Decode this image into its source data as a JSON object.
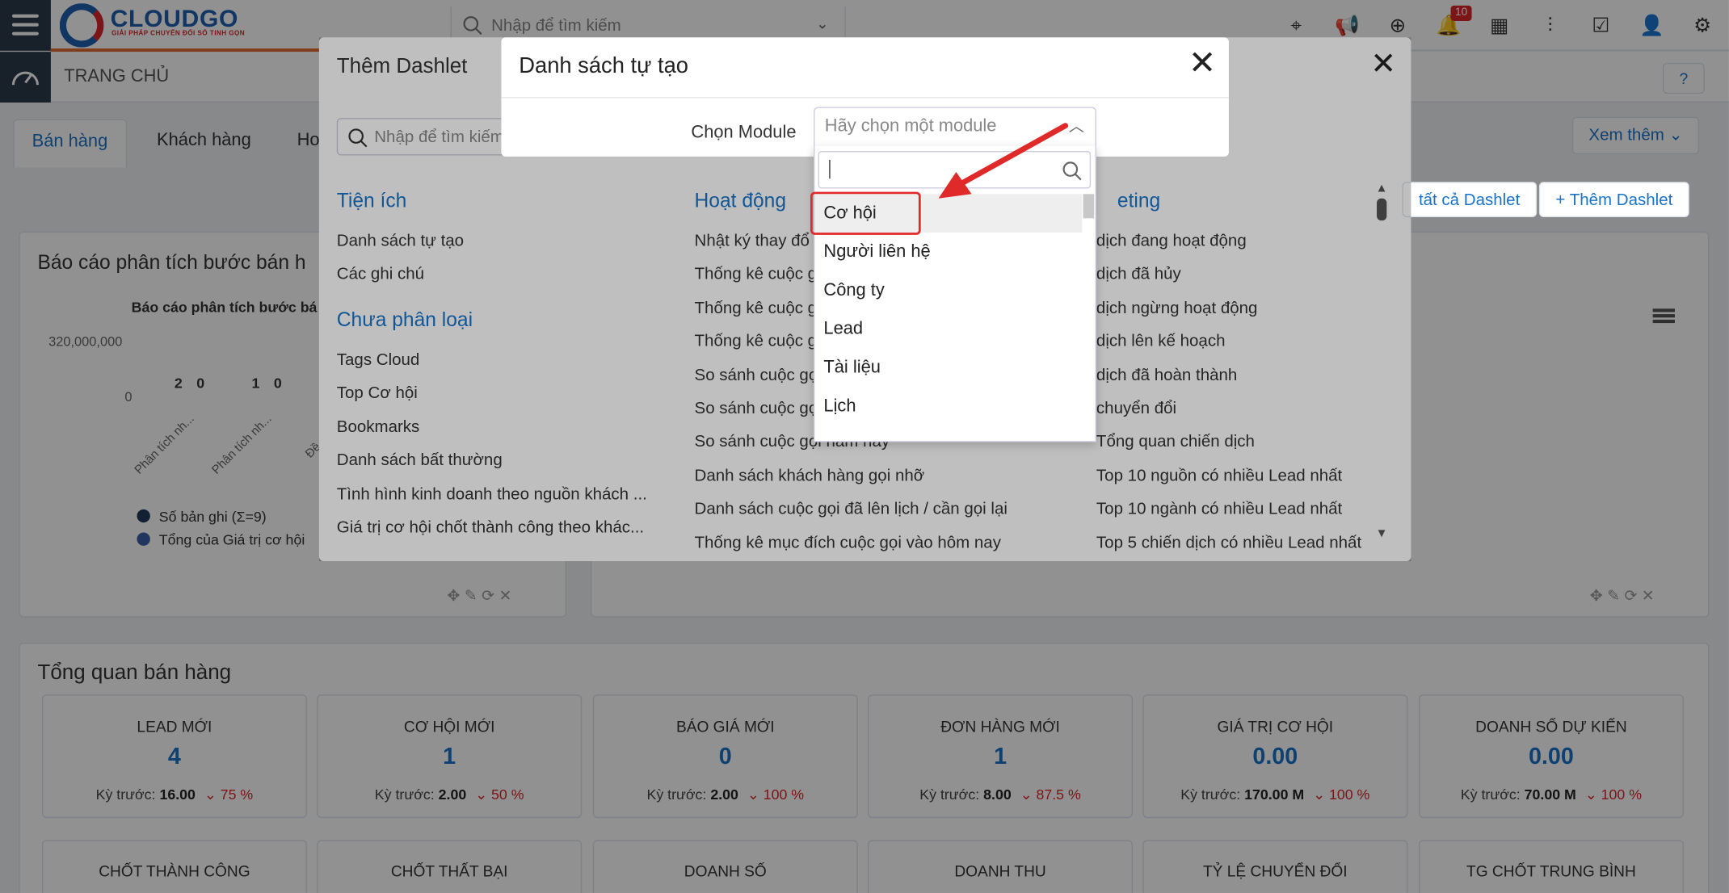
{
  "header": {
    "logo": "CLOUDGO",
    "logo_sub": "GIẢI PHÁP CHUYỂN ĐỔI SỐ TINH GỌN",
    "search_placeholder": "Nhập để tìm kiếm",
    "notification_count": "10",
    "icons": [
      "map-marker-icon",
      "megaphone-icon",
      "plus-circle-icon",
      "bell-icon",
      "calendar-icon",
      "chart-icon",
      "checkbox-icon",
      "user-icon",
      "gear-icon"
    ]
  },
  "subbar": {
    "title": "TRANG CHỦ",
    "help": "?"
  },
  "tabs": [
    "Bán hàng",
    "Khách hàng",
    "Ho"
  ],
  "see_more": "Xem thêm",
  "panel1": {
    "title": "Báo cáo phân tích bước bán h",
    "chart_title": "Báo cáo phân tích bước bá"
  },
  "chart_data": {
    "type": "bar",
    "title": "Báo cáo phân tích bước bá",
    "categories": [
      "Phân tích nh...",
      "Phân tích nh...",
      "Đề xuất/..."
    ],
    "yticks": [
      "320,000,000",
      "0"
    ],
    "data_labels": [
      "2",
      "0",
      "1",
      "0"
    ],
    "series": [
      {
        "name": "Số bản ghi (Σ=9)",
        "color": "#1f3a5a"
      },
      {
        "name": "Tổng của Giá trị cơ hội",
        "color": "#3a5fa8"
      }
    ]
  },
  "overview": {
    "title": "Tổng quan bán hàng",
    "prev_label": "Kỳ trước:",
    "cards": [
      {
        "title": "LEAD MỚI",
        "value": "4",
        "prev": "16.00",
        "change": "75 %"
      },
      {
        "title": "CƠ HỘI MỚI",
        "value": "1",
        "prev": "2.00",
        "change": "50 %"
      },
      {
        "title": "BÁO GIÁ MỚI",
        "value": "0",
        "prev": "2.00",
        "change": "100 %"
      },
      {
        "title": "ĐƠN HÀNG MỚI",
        "value": "1",
        "prev": "8.00",
        "change": "87.5 %"
      },
      {
        "title": "GIÁ TRỊ CƠ HỘI",
        "value": "0.00",
        "prev": "170.00 M",
        "change": "100 %"
      },
      {
        "title": "DOANH SỐ DỰ KIẾN",
        "value": "0.00",
        "prev": "70.00 M",
        "change": "100 %"
      }
    ],
    "cards2": [
      "CHỐT THÀNH CÔNG",
      "CHỐT THẤT BẠI",
      "DOANH SỐ",
      "DOANH THU",
      "TỶ LỆ CHUYỂN ĐỔI",
      "TG CHỐT TRUNG BÌNH"
    ]
  },
  "dashlet_dialog": {
    "title": "Thêm Dashlet",
    "search_placeholder": "Nhập để tìm kiếm",
    "all_dashlets": "tất cả Dashlet",
    "add_dashlet": "+ Thêm Dashlet",
    "col1_title": "Tiện ích",
    "col1_items": [
      "Danh sách tự tạo",
      "Các ghi chú"
    ],
    "col1b_title": "Chưa phân loại",
    "col1b_items": [
      "Tags Cloud",
      "Top Cơ hội",
      "Bookmarks",
      "Danh sách bất thường",
      "Tình hình kinh doanh theo nguồn khách ...",
      "Giá trị cơ hội chốt thành công theo khác..."
    ],
    "col2_title": "Hoạt động",
    "col2_items": [
      "Nhật ký thay đổ",
      "Thống kê cuộc g",
      "Thống kê cuộc g",
      "Thống kê cuộc g",
      "So sánh cuộc gọ",
      "So sánh cuộc gọ",
      "So sánh cuộc gọi năm nay",
      "Danh sách khách hàng gọi nhỡ",
      "Danh sách cuộc gọi đã lên lịch / cần gọi lại",
      "Thống kê mục đích cuộc gọi vào hôm nay"
    ],
    "col3_title": "eting",
    "col3_items": [
      "dịch đang hoạt động",
      "dịch đã hủy",
      "dịch ngừng hoạt động",
      "dịch lên kế hoạch",
      "dịch đã hoàn thành",
      "chuyển đổi",
      "Tổng quan chiến dịch",
      "Top 10 nguồn có nhiều Lead nhất",
      "Top 10 ngành có nhiều Lead nhất",
      "Top 5 chiến dịch có nhiều Lead nhất"
    ]
  },
  "custom_list_dialog": {
    "title": "Danh sách tự tạo",
    "module_label": "Chọn Module",
    "select_placeholder": "Hãy chọn một module",
    "options": [
      "Cơ hội",
      "Người liên hệ",
      "Công ty",
      "Lead",
      "Tài liệu",
      "Lịch"
    ],
    "highlight_color": "#e02a2a"
  }
}
